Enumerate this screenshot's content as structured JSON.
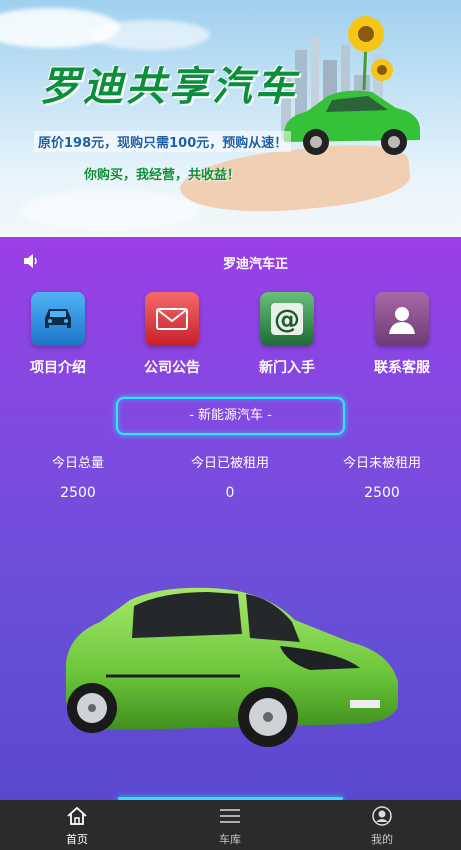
{
  "banner": {
    "title": "罗迪共享汽车",
    "promo": "原价198元，现购只需100元，预购从速！",
    "slogan": "你购买，我经营，共收益！"
  },
  "notice": {
    "icon": "speaker-icon",
    "text": "罗迪汽车正"
  },
  "menu": {
    "items": [
      {
        "label": "项目介绍",
        "icon": "car-icon",
        "color": "#2b8fe0"
      },
      {
        "label": "公司公告",
        "icon": "mail-icon",
        "color": "#e23a3a"
      },
      {
        "label": "新门入手",
        "icon": "at-icon",
        "color": "#3b9a4e"
      },
      {
        "label": "联系客服",
        "icon": "user-icon",
        "color": "#8b4f8f"
      }
    ]
  },
  "category": {
    "label": "- 新能源汽车 -"
  },
  "stats": [
    {
      "label": "今日总量",
      "value": "2500"
    },
    {
      "label": "今日已被租用",
      "value": "0"
    },
    {
      "label": "今日未被租用",
      "value": "2500"
    }
  ],
  "tabbar": {
    "items": [
      {
        "label": "首页",
        "icon": "home-icon",
        "active": true
      },
      {
        "label": "车库",
        "icon": "menu-icon",
        "active": false
      },
      {
        "label": "我的",
        "icon": "profile-icon",
        "active": false
      }
    ]
  },
  "colors": {
    "accent": "#2ee6ff",
    "tabbar_bg": "#2b2b2b",
    "brand_green": "#0a8f3a"
  }
}
